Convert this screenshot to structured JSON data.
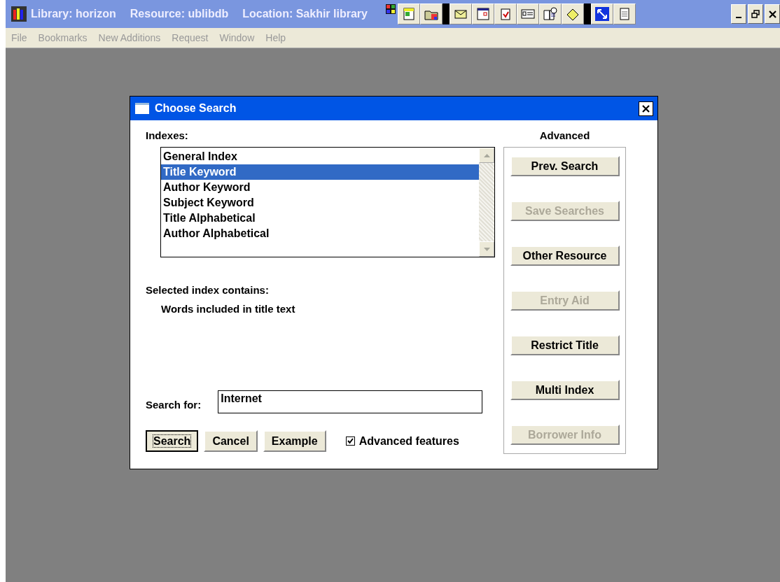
{
  "window": {
    "title_parts": [
      "Library: horizon",
      "Resource: ublibdb",
      "Location: Sakhir library"
    ]
  },
  "menu": [
    "File",
    "Bookmarks",
    "New Additions",
    "Request",
    "Window",
    "Help"
  ],
  "dialog": {
    "title": "Choose Search",
    "indexes_label": "Indexes:",
    "indexes": [
      {
        "label": "General Index",
        "selected": false
      },
      {
        "label": "Title Keyword",
        "selected": true
      },
      {
        "label": "Author Keyword",
        "selected": false
      },
      {
        "label": "Subject Keyword",
        "selected": false
      },
      {
        "label": "Title Alphabetical",
        "selected": false
      },
      {
        "label": "Author Alphabetical",
        "selected": false
      }
    ],
    "contains_label": "Selected index contains:",
    "contains_text": "Words included in title text",
    "search_label": "Search for:",
    "search_value": "Internet",
    "buttons": [
      {
        "label": "Search",
        "focused": true
      },
      {
        "label": "Cancel",
        "focused": false
      },
      {
        "label": "Example",
        "focused": false
      }
    ],
    "advanced_checkbox": {
      "label": "Advanced features",
      "checked": true
    },
    "advanced": {
      "heading": "Advanced",
      "buttons": [
        {
          "label": "Prev. Search",
          "disabled": false
        },
        {
          "label": "Save Searches",
          "disabled": true
        },
        {
          "label": "Other Resource",
          "disabled": false
        },
        {
          "label": "Entry Aid",
          "disabled": true
        },
        {
          "label": "Restrict Title",
          "disabled": false
        },
        {
          "label": "Multi Index",
          "disabled": false
        },
        {
          "label": "Borrower Info",
          "disabled": true
        }
      ]
    }
  }
}
